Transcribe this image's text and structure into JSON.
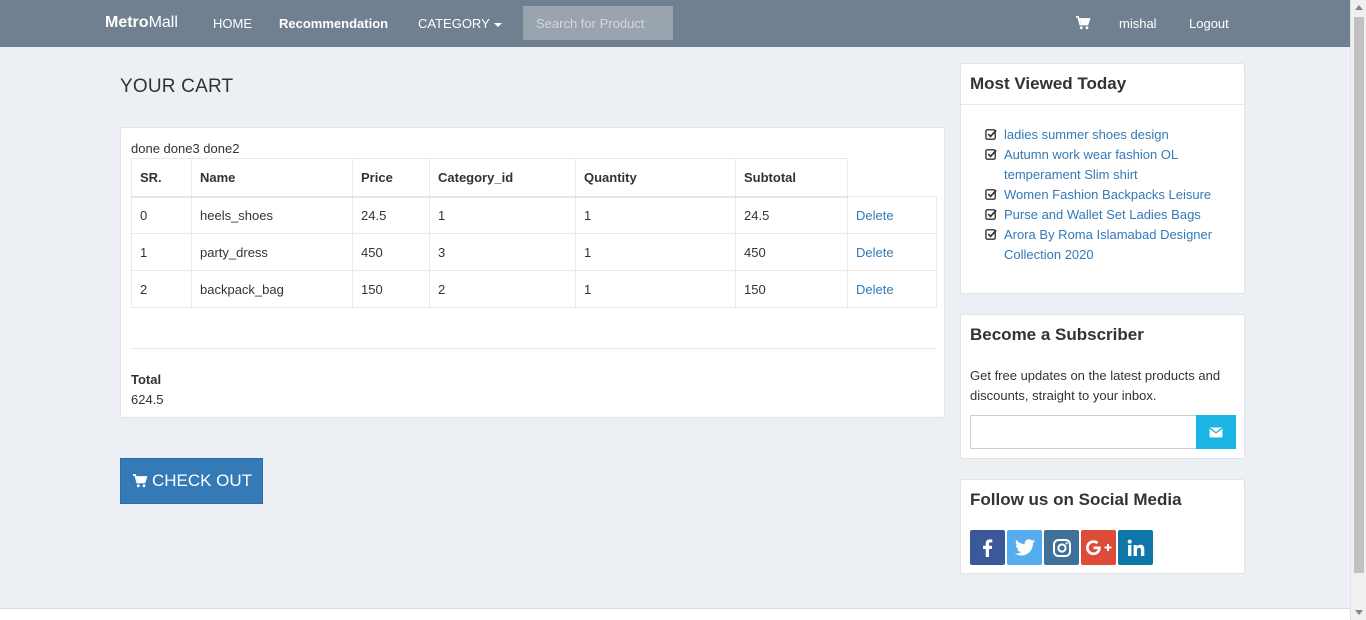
{
  "navbar": {
    "brand_bold": "Metro",
    "brand_rest": "Mall",
    "home": "HOME",
    "recommendation": "Recommendation",
    "category": "CATEGORY",
    "search_placeholder": "Search for Product",
    "user": "mishal",
    "logout": "Logout"
  },
  "cart": {
    "title": "YOUR CART",
    "debug_text": "done done3 done2",
    "columns": [
      "SR.",
      "Name",
      "Price",
      "Category_id",
      "Quantity",
      "Subtotal"
    ],
    "rows": [
      {
        "sr": "0",
        "name": "heels_shoes",
        "price": "24.5",
        "category_id": "1",
        "quantity": "1",
        "subtotal": "24.5",
        "action": "Delete"
      },
      {
        "sr": "1",
        "name": "party_dress",
        "price": "450",
        "category_id": "3",
        "quantity": "1",
        "subtotal": "450",
        "action": "Delete"
      },
      {
        "sr": "2",
        "name": "backpack_bag",
        "price": "150",
        "category_id": "2",
        "quantity": "1",
        "subtotal": "150",
        "action": "Delete"
      }
    ],
    "total_label": "Total",
    "total_value": "624.5",
    "checkout_label": "CHECK OUT"
  },
  "sidebar": {
    "most_viewed": {
      "title": "Most Viewed Today",
      "items": [
        "ladies summer shoes design",
        "Autumn work wear fashion OL temperament Slim shirt",
        "Women Fashion Backpacks Leisure",
        "Purse and Wallet Set Ladies Bags",
        "Arora By Roma Islamabad Designer Collection 2020"
      ]
    },
    "subscriber": {
      "title": "Become a Subscriber",
      "text": "Get free updates on the latest products and discounts, straight to your inbox."
    },
    "social": {
      "title": "Follow us on Social Media",
      "icons": [
        "facebook-icon",
        "twitter-icon",
        "instagram-icon",
        "google-plus-icon",
        "linkedin-icon"
      ]
    }
  },
  "colors": {
    "navbar": "#708090",
    "primary": "#337ab7",
    "subscribe": "#1ab5e5"
  }
}
